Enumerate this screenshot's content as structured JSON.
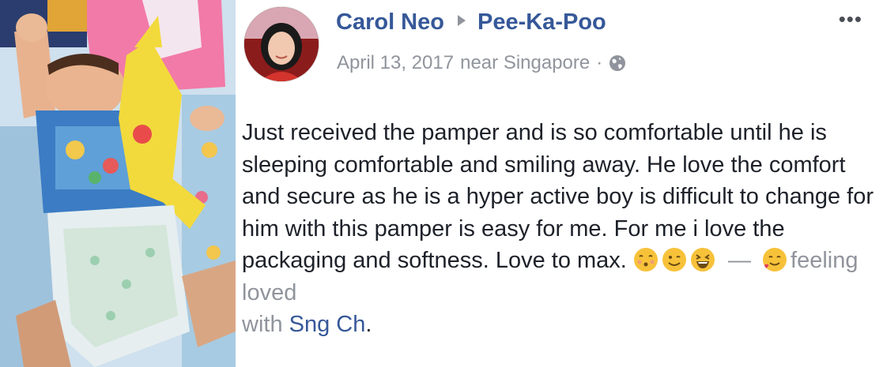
{
  "post": {
    "author": "Carol Neo",
    "page": "Pee-Ka-Poo",
    "date": "April 13, 2017",
    "location": "near Singapore",
    "separator": "·",
    "more_label": "•••",
    "text": "Just received the pamper and is so comfortable until he is sleeping comfortable and smiling away. He love the comfort and secure as he is a hyper active boy is difficult to change for him with this pamper is easy for me. For me i love the packaging and softness. Love to max.",
    "dash": "—",
    "feeling": "feeling loved",
    "with_label": "with",
    "tagged": "Sng Ch",
    "end": "."
  },
  "icons": {
    "arrow": "triangle-right-icon",
    "globe": "globe-icon",
    "emojis": [
      "kissing-face-icon",
      "winking-face-icon",
      "grinning-squinting-face-icon",
      "smiling-face-with-hearts-icon"
    ]
  },
  "colors": {
    "link": "#365899",
    "meta": "#90949c",
    "text": "#1d2129"
  }
}
